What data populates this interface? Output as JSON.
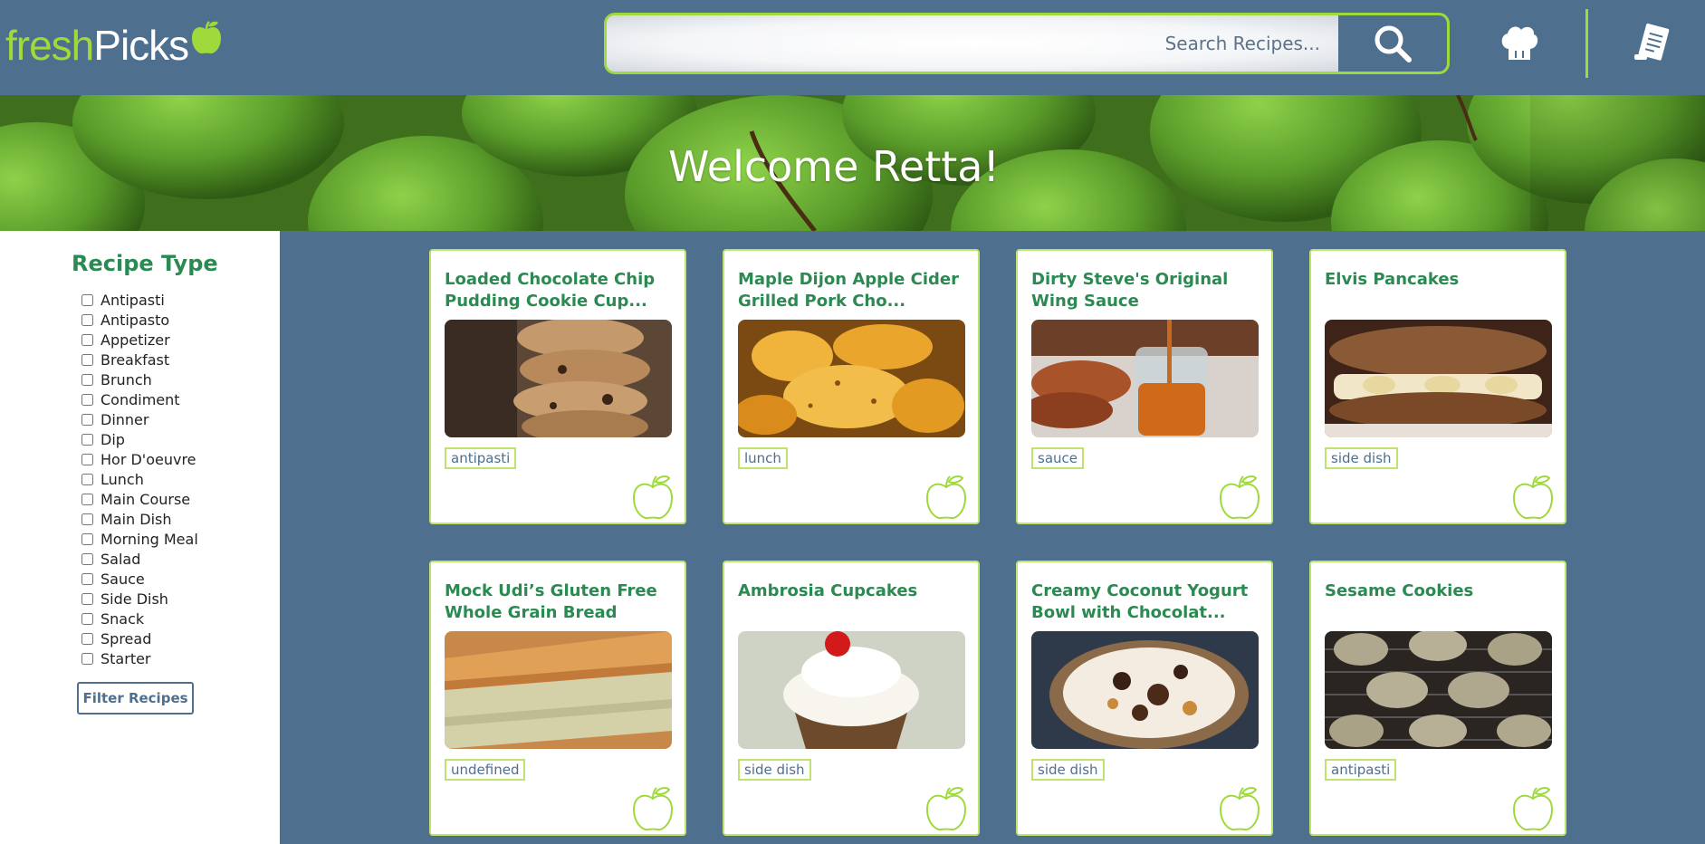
{
  "header": {
    "logo_fresh": "fresh",
    "logo_picks": "Picks",
    "search_placeholder": "Search Recipes...",
    "icons": {
      "search": "search-icon",
      "chef": "chef-hat-icon",
      "list": "recipe-list-icon",
      "logo": "apple-icon"
    }
  },
  "hero": {
    "welcome": "Welcome  Retta!"
  },
  "sidebar": {
    "title": "Recipe Type",
    "types": [
      "Antipasti",
      "Antipasto",
      "Appetizer",
      "Breakfast",
      "Brunch",
      "Condiment",
      "Dinner",
      "Dip",
      "Hor D'oeuvre",
      "Lunch",
      "Main Course",
      "Main Dish",
      "Morning Meal",
      "Salad",
      "Sauce",
      "Side Dish",
      "Snack",
      "Spread",
      "Starter"
    ],
    "filter_label": "Filter Recipes"
  },
  "recipes": [
    {
      "title": "Loaded Chocolate Chip Pudding Cookie Cup...",
      "tag": "antipasti"
    },
    {
      "title": "Maple Dijon Apple Cider Grilled Pork Cho...",
      "tag": "lunch"
    },
    {
      "title": "Dirty Steve's Original Wing Sauce",
      "tag": "sauce"
    },
    {
      "title": "Elvis Pancakes",
      "tag": "side dish"
    },
    {
      "title": "Mock Udi’s Gluten Free Whole Grain Bread",
      "tag": "undefined"
    },
    {
      "title": "Ambrosia Cupcakes",
      "tag": "side dish"
    },
    {
      "title": "Creamy Coconut Yogurt Bowl with Chocolat...",
      "tag": "side dish"
    },
    {
      "title": "Sesame Cookies",
      "tag": "antipasti"
    }
  ],
  "colors": {
    "primary": "#4f6f8f",
    "accent": "#9fd93c",
    "title_green": "#2b8a52"
  }
}
